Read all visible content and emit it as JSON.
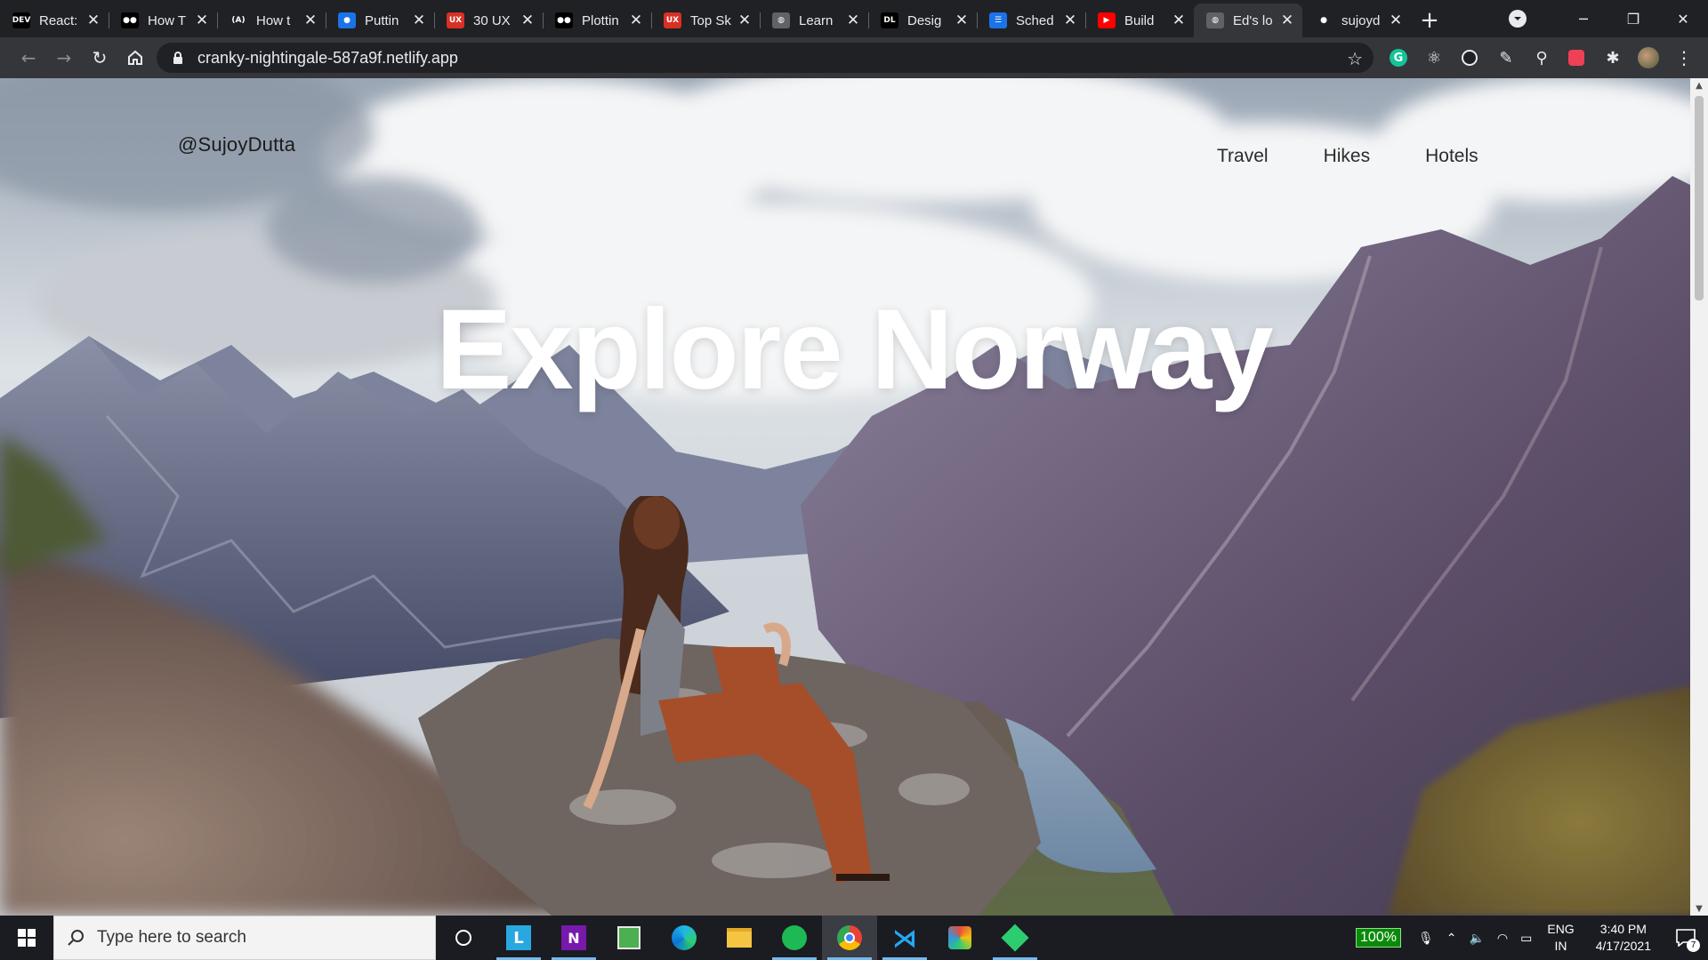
{
  "browser": {
    "tabs": [
      {
        "title": "React:",
        "favicon": "dev-icon",
        "fav_text": "DEV",
        "fav_color": "#000000"
      },
      {
        "title": "How T",
        "favicon": "medium-icon",
        "fav_text": "●●",
        "fav_color": "#000000"
      },
      {
        "title": "How t",
        "favicon": "angular-icon",
        "fav_text": "(A)",
        "fav_color": "#202124"
      },
      {
        "title": "Puttin",
        "favicon": "circle-icon",
        "fav_text": "●",
        "fav_color": "#1a73e8"
      },
      {
        "title": "30 UX",
        "favicon": "ux-icon",
        "fav_text": "UX",
        "fav_color": "#d93025"
      },
      {
        "title": "Plottin",
        "favicon": "medium-icon",
        "fav_text": "●●",
        "fav_color": "#000000"
      },
      {
        "title": "Top Sk",
        "favicon": "ux-icon",
        "fav_text": "UX",
        "fav_color": "#d93025"
      },
      {
        "title": "Learn",
        "favicon": "globe-icon",
        "fav_text": "◍",
        "fav_color": "#5f6368"
      },
      {
        "title": "Desig",
        "favicon": "dl-icon",
        "fav_text": "DL",
        "fav_color": "#000000"
      },
      {
        "title": "Sched",
        "favicon": "lines-icon",
        "fav_text": "☰",
        "fav_color": "#1a73e8"
      },
      {
        "title": "Build",
        "favicon": "youtube-icon",
        "fav_text": "▶",
        "fav_color": "#ff0000"
      },
      {
        "title": "Ed's lo",
        "favicon": "globe-icon",
        "fav_text": "◍",
        "fav_color": "#5f6368",
        "active": true
      },
      {
        "title": "sujoyd",
        "favicon": "github-icon",
        "fav_text": "●",
        "fav_color": "#202124"
      }
    ],
    "close_glyph": "✕",
    "new_tab_glyph": "+",
    "url": "cranky-nightingale-587a9f.netlify.app"
  },
  "page": {
    "brand": "@SujoyDutta",
    "nav": [
      "Travel",
      "Hikes",
      "Hotels"
    ],
    "hero_title": "Explore Norway"
  },
  "taskbar": {
    "search_placeholder": "Type here to search",
    "battery_percent": "100%",
    "language": "ENG",
    "region": "IN",
    "time": "3:40 PM",
    "date": "4/17/2021",
    "notification_count": "7"
  }
}
